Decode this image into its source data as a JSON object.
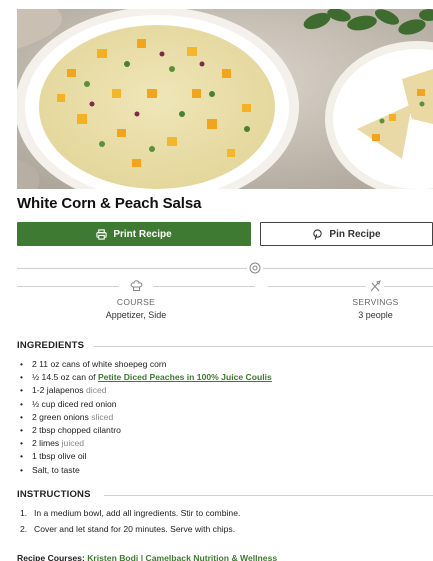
{
  "recipe": {
    "title": "White Corn & Peach Salsa"
  },
  "buttons": {
    "print_label": "Print Recipe",
    "pin_label": "Pin Recipe"
  },
  "meta": {
    "course_label": "COURSE",
    "course_value": "Appetizer, Side",
    "servings_label": "SERVINGS",
    "servings_value": "3 people"
  },
  "ingredients": {
    "heading": "INGREDIENTS",
    "items": [
      {
        "text": "2 11 oz cans of white shoepeg corn"
      },
      {
        "text": "½ 14.5 oz can of ",
        "link": "Petite Diced Peaches in 100% Juice Coulis"
      },
      {
        "text": "1-2 jalapenos",
        "note": "diced"
      },
      {
        "text": "½ cup diced red onion"
      },
      {
        "text": "2 green onions",
        "note": "sliced"
      },
      {
        "text": "2 tbsp chopped cilantro"
      },
      {
        "text": "2 limes",
        "note": "juiced"
      },
      {
        "text": "1 tbsp olive oil"
      },
      {
        "text": "Salt, to taste"
      }
    ]
  },
  "instructions": {
    "heading": "INSTRUCTIONS",
    "steps": [
      {
        "num": "1.",
        "text": "In a medium bowl, add all ingredients. Stir to combine."
      },
      {
        "num": "2.",
        "text": "Cover and let stand for 20 minutes. Serve with chips."
      }
    ]
  },
  "credit": {
    "label": "Recipe Courses:",
    "link": "Kristen Bodi | Camelback Nutrition & Wellness"
  },
  "icons": {
    "print": "printer-icon",
    "pin": "pinterest-icon",
    "time": "clock-icon",
    "course": "chef-hat-icon",
    "servings": "utensils-icon"
  },
  "colors": {
    "accent": "#3f7a33",
    "muted": "#888888"
  }
}
